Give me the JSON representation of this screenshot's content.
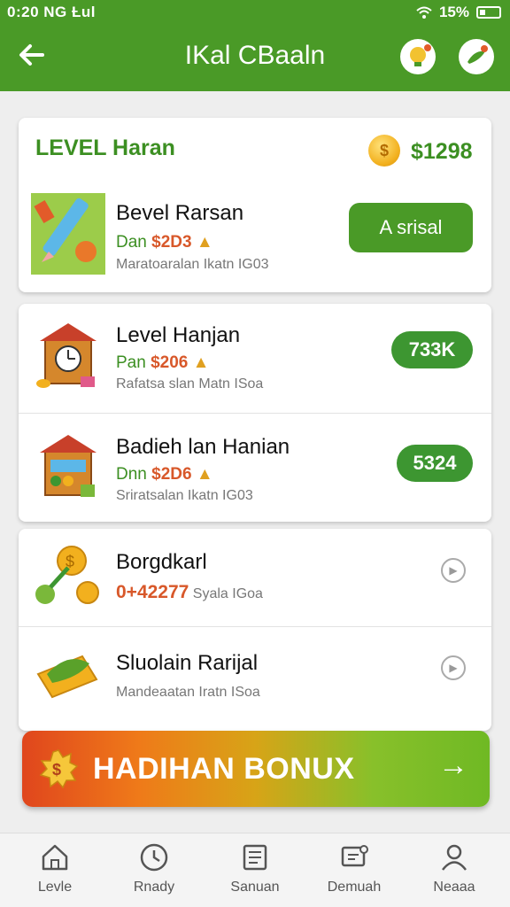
{
  "status": {
    "time": "0:20",
    "carrier": "NG",
    "signal": "Ƚul",
    "battery": "15%"
  },
  "appbar": {
    "title": "IKal CBaaln",
    "back_icon": "arrow-left-icon",
    "icons": [
      "lightbulb-icon",
      "bird-icon"
    ]
  },
  "card1": {
    "title": "LEVEL Haran",
    "balance": "$1298",
    "item": {
      "name": "Bevel Rarsan",
      "price_prefix": "Dan",
      "price": "$2D3",
      "sub": "Maratoaralan Ikatn IG03",
      "button": "A srisal"
    }
  },
  "card2": {
    "items": [
      {
        "name": "Level Hanjan",
        "price_prefix": "Pan",
        "price": "$206",
        "sub": "Rafatsa slan Matn ISoa",
        "badge": "733K"
      },
      {
        "name": "Badieh lan Hanian",
        "price_prefix": "Dnn",
        "price": "$2D6",
        "sub": "Sriratsalan Ikatn IG03",
        "badge": "5324"
      }
    ]
  },
  "card3": {
    "items": [
      {
        "name": "Borgdkarl",
        "amount": "0+42277",
        "sub": "Syala IGoa"
      },
      {
        "name": "Sluolain Rarijal",
        "sub": "Mandeaatan Iratn ISoa"
      }
    ]
  },
  "bonus": {
    "label": "HADIHAN BONUX",
    "arrow": "→"
  },
  "nav": [
    {
      "label": "Levle",
      "icon": "home-icon"
    },
    {
      "label": "Rnady",
      "icon": "clock-icon"
    },
    {
      "label": "Sanuan",
      "icon": "document-icon"
    },
    {
      "label": "Demuah",
      "icon": "chat-icon"
    },
    {
      "label": "Neaaa",
      "icon": "profile-icon"
    }
  ],
  "colors": {
    "primary": "#4a9a27",
    "accent_price": "#d8582a",
    "badge": "#3d9631"
  }
}
